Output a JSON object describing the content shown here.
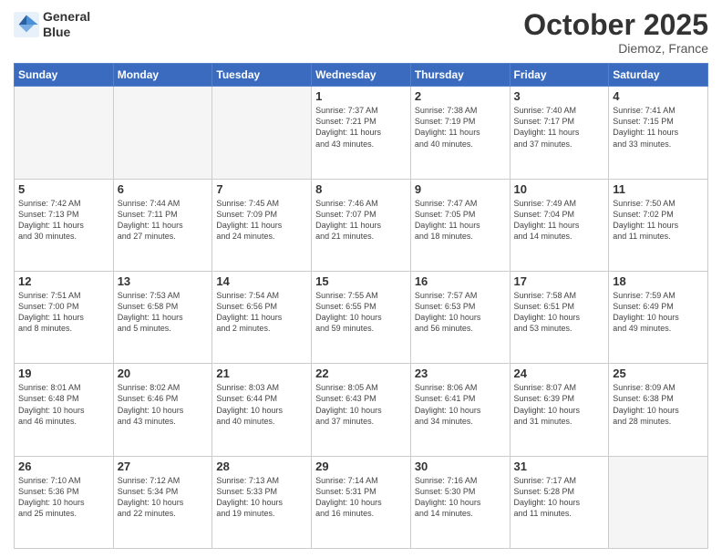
{
  "header": {
    "logo_line1": "General",
    "logo_line2": "Blue",
    "month": "October 2025",
    "location": "Diemoz, France"
  },
  "weekdays": [
    "Sunday",
    "Monday",
    "Tuesday",
    "Wednesday",
    "Thursday",
    "Friday",
    "Saturday"
  ],
  "weeks": [
    [
      {
        "day": "",
        "info": ""
      },
      {
        "day": "",
        "info": ""
      },
      {
        "day": "",
        "info": ""
      },
      {
        "day": "1",
        "info": "Sunrise: 7:37 AM\nSunset: 7:21 PM\nDaylight: 11 hours\nand 43 minutes."
      },
      {
        "day": "2",
        "info": "Sunrise: 7:38 AM\nSunset: 7:19 PM\nDaylight: 11 hours\nand 40 minutes."
      },
      {
        "day": "3",
        "info": "Sunrise: 7:40 AM\nSunset: 7:17 PM\nDaylight: 11 hours\nand 37 minutes."
      },
      {
        "day": "4",
        "info": "Sunrise: 7:41 AM\nSunset: 7:15 PM\nDaylight: 11 hours\nand 33 minutes."
      }
    ],
    [
      {
        "day": "5",
        "info": "Sunrise: 7:42 AM\nSunset: 7:13 PM\nDaylight: 11 hours\nand 30 minutes."
      },
      {
        "day": "6",
        "info": "Sunrise: 7:44 AM\nSunset: 7:11 PM\nDaylight: 11 hours\nand 27 minutes."
      },
      {
        "day": "7",
        "info": "Sunrise: 7:45 AM\nSunset: 7:09 PM\nDaylight: 11 hours\nand 24 minutes."
      },
      {
        "day": "8",
        "info": "Sunrise: 7:46 AM\nSunset: 7:07 PM\nDaylight: 11 hours\nand 21 minutes."
      },
      {
        "day": "9",
        "info": "Sunrise: 7:47 AM\nSunset: 7:05 PM\nDaylight: 11 hours\nand 18 minutes."
      },
      {
        "day": "10",
        "info": "Sunrise: 7:49 AM\nSunset: 7:04 PM\nDaylight: 11 hours\nand 14 minutes."
      },
      {
        "day": "11",
        "info": "Sunrise: 7:50 AM\nSunset: 7:02 PM\nDaylight: 11 hours\nand 11 minutes."
      }
    ],
    [
      {
        "day": "12",
        "info": "Sunrise: 7:51 AM\nSunset: 7:00 PM\nDaylight: 11 hours\nand 8 minutes."
      },
      {
        "day": "13",
        "info": "Sunrise: 7:53 AM\nSunset: 6:58 PM\nDaylight: 11 hours\nand 5 minutes."
      },
      {
        "day": "14",
        "info": "Sunrise: 7:54 AM\nSunset: 6:56 PM\nDaylight: 11 hours\nand 2 minutes."
      },
      {
        "day": "15",
        "info": "Sunrise: 7:55 AM\nSunset: 6:55 PM\nDaylight: 10 hours\nand 59 minutes."
      },
      {
        "day": "16",
        "info": "Sunrise: 7:57 AM\nSunset: 6:53 PM\nDaylight: 10 hours\nand 56 minutes."
      },
      {
        "day": "17",
        "info": "Sunrise: 7:58 AM\nSunset: 6:51 PM\nDaylight: 10 hours\nand 53 minutes."
      },
      {
        "day": "18",
        "info": "Sunrise: 7:59 AM\nSunset: 6:49 PM\nDaylight: 10 hours\nand 49 minutes."
      }
    ],
    [
      {
        "day": "19",
        "info": "Sunrise: 8:01 AM\nSunset: 6:48 PM\nDaylight: 10 hours\nand 46 minutes."
      },
      {
        "day": "20",
        "info": "Sunrise: 8:02 AM\nSunset: 6:46 PM\nDaylight: 10 hours\nand 43 minutes."
      },
      {
        "day": "21",
        "info": "Sunrise: 8:03 AM\nSunset: 6:44 PM\nDaylight: 10 hours\nand 40 minutes."
      },
      {
        "day": "22",
        "info": "Sunrise: 8:05 AM\nSunset: 6:43 PM\nDaylight: 10 hours\nand 37 minutes."
      },
      {
        "day": "23",
        "info": "Sunrise: 8:06 AM\nSunset: 6:41 PM\nDaylight: 10 hours\nand 34 minutes."
      },
      {
        "day": "24",
        "info": "Sunrise: 8:07 AM\nSunset: 6:39 PM\nDaylight: 10 hours\nand 31 minutes."
      },
      {
        "day": "25",
        "info": "Sunrise: 8:09 AM\nSunset: 6:38 PM\nDaylight: 10 hours\nand 28 minutes."
      }
    ],
    [
      {
        "day": "26",
        "info": "Sunrise: 7:10 AM\nSunset: 5:36 PM\nDaylight: 10 hours\nand 25 minutes."
      },
      {
        "day": "27",
        "info": "Sunrise: 7:12 AM\nSunset: 5:34 PM\nDaylight: 10 hours\nand 22 minutes."
      },
      {
        "day": "28",
        "info": "Sunrise: 7:13 AM\nSunset: 5:33 PM\nDaylight: 10 hours\nand 19 minutes."
      },
      {
        "day": "29",
        "info": "Sunrise: 7:14 AM\nSunset: 5:31 PM\nDaylight: 10 hours\nand 16 minutes."
      },
      {
        "day": "30",
        "info": "Sunrise: 7:16 AM\nSunset: 5:30 PM\nDaylight: 10 hours\nand 14 minutes."
      },
      {
        "day": "31",
        "info": "Sunrise: 7:17 AM\nSunset: 5:28 PM\nDaylight: 10 hours\nand 11 minutes."
      },
      {
        "day": "",
        "info": ""
      }
    ]
  ]
}
